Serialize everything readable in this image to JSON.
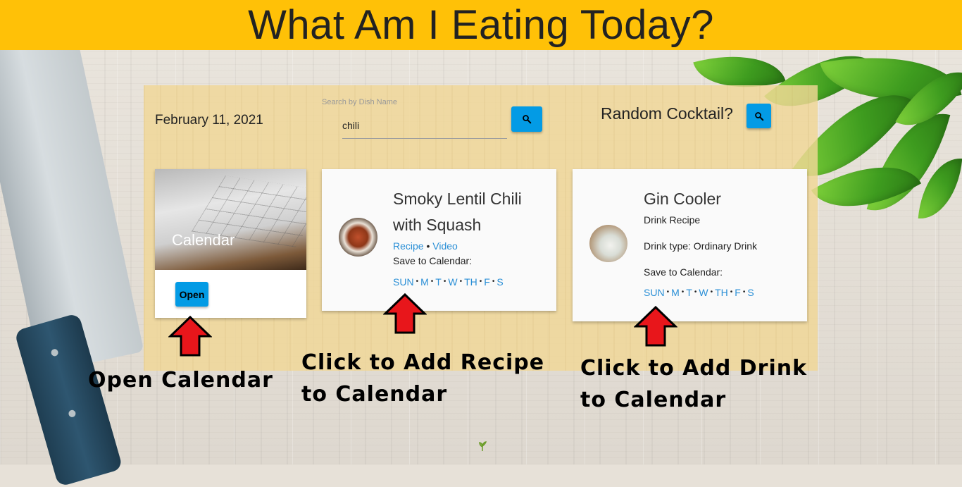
{
  "header": {
    "title": "What Am I Eating Today?"
  },
  "top_bar": {
    "date": "February 11, 2021",
    "search": {
      "label": "Search by Dish Name",
      "value": "chili"
    },
    "cocktail_label": "Random Cocktail?"
  },
  "calendar_card": {
    "title": "Calendar",
    "open_label": "Open"
  },
  "recipe_card": {
    "title_line1": "Smoky Lentil Chili",
    "title_line2": "with Squash",
    "recipe_link": "Recipe",
    "video_link": "Video",
    "save_label": "Save to Calendar:",
    "days": [
      "SUN",
      "M",
      "T",
      "W",
      "TH",
      "F",
      "S"
    ]
  },
  "drink_card": {
    "title": "Gin Cooler",
    "recipe_link": "Drink Recipe",
    "drink_type": "Drink type: Ordinary Drink",
    "save_label": "Save to Calendar:",
    "days": [
      "SUN",
      "M",
      "T",
      "W",
      "TH",
      "F",
      "S"
    ]
  },
  "annotations": {
    "open_calendar": "Open Calendar",
    "add_recipe_line1": "Click to Add Recipe",
    "add_recipe_line2": "to Calendar",
    "add_drink_line1": "Click to Add Drink",
    "add_drink_line2": "to Calendar"
  },
  "colors": {
    "header": "#ffc107",
    "button": "#039be5",
    "link": "#2a8fd6",
    "arrow": "#e8161b"
  }
}
